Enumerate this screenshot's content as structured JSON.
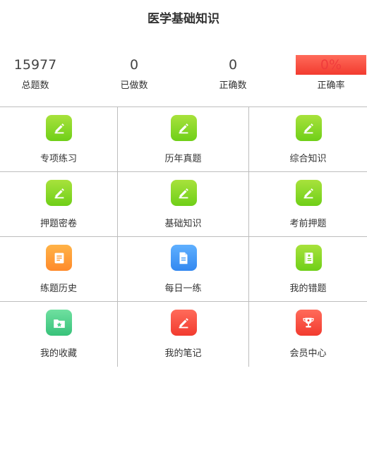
{
  "header": {
    "title": "医学基础知识"
  },
  "stats": [
    {
      "value": "15977",
      "label": "总题数"
    },
    {
      "value": "0",
      "label": "已做数"
    },
    {
      "value": "0",
      "label": "正确数"
    },
    {
      "value": "0%",
      "label": "正确率"
    }
  ],
  "colors": {
    "accent_red": "#f03c3c",
    "green": "#7ed321",
    "orange": "#ff9933",
    "blue": "#4a9ff5",
    "teal": "#4ccf8a"
  },
  "menu": [
    {
      "label": "专项练习",
      "icon": "edit-icon"
    },
    {
      "label": "历年真题",
      "icon": "edit-icon"
    },
    {
      "label": "综合知识",
      "icon": "edit-icon"
    },
    {
      "label": "押题密卷",
      "icon": "edit-icon"
    },
    {
      "label": "基础知识",
      "icon": "edit-icon"
    },
    {
      "label": "考前押题",
      "icon": "edit-icon"
    },
    {
      "label": "练题历史",
      "icon": "history-icon"
    },
    {
      "label": "每日一练",
      "icon": "document-icon"
    },
    {
      "label": "我的错题",
      "icon": "wrong-book-icon"
    },
    {
      "label": "我的收藏",
      "icon": "favorite-folder-icon"
    },
    {
      "label": "我的笔记",
      "icon": "note-edit-icon"
    },
    {
      "label": "会员中心",
      "icon": "trophy-icon"
    }
  ]
}
